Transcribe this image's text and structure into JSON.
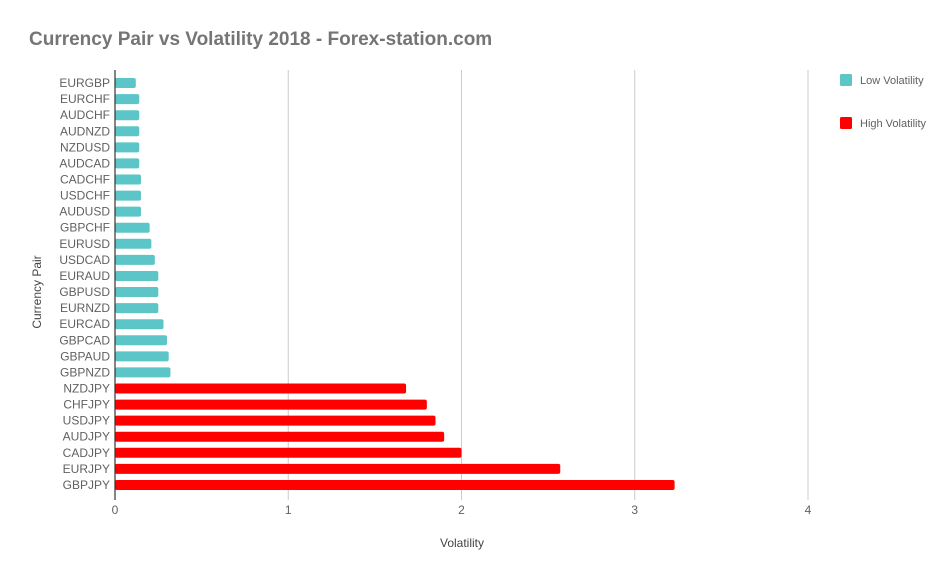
{
  "chart_data": {
    "type": "bar",
    "orientation": "horizontal",
    "title": "Currency Pair vs Volatility 2018 - Forex-station.com",
    "xlabel": "Volatility",
    "ylabel": "Currency Pair",
    "xlim": [
      0,
      4
    ],
    "xticks": [
      0,
      1,
      2,
      3,
      4
    ],
    "grid": true,
    "legend_position": "top-right",
    "categories": [
      "EURGBP",
      "EURCHF",
      "AUDCHF",
      "AUDNZD",
      "NZDUSD",
      "AUDCAD",
      "CADCHF",
      "USDCHF",
      "AUDUSD",
      "GBPCHF",
      "EURUSD",
      "USDCAD",
      "EURAUD",
      "GBPUSD",
      "EURNZD",
      "EURCAD",
      "GBPCAD",
      "GBPAUD",
      "GBPNZD",
      "NZDJPY",
      "CHFJPY",
      "USDJPY",
      "AUDJPY",
      "CADJPY",
      "EURJPY",
      "GBPJPY"
    ],
    "series": [
      {
        "name": "Low Volatility",
        "color": "#5bc5c7",
        "values": [
          0.12,
          0.14,
          0.14,
          0.14,
          0.14,
          0.14,
          0.15,
          0.15,
          0.15,
          0.2,
          0.21,
          0.23,
          0.25,
          0.25,
          0.25,
          0.28,
          0.3,
          0.31,
          0.32,
          null,
          null,
          null,
          null,
          null,
          null,
          null
        ]
      },
      {
        "name": "High Volatility",
        "color": "#ff0000",
        "values": [
          null,
          null,
          null,
          null,
          null,
          null,
          null,
          null,
          null,
          null,
          null,
          null,
          null,
          null,
          null,
          null,
          null,
          null,
          null,
          1.68,
          1.8,
          1.85,
          1.9,
          2.0,
          2.57,
          3.23
        ]
      }
    ]
  }
}
